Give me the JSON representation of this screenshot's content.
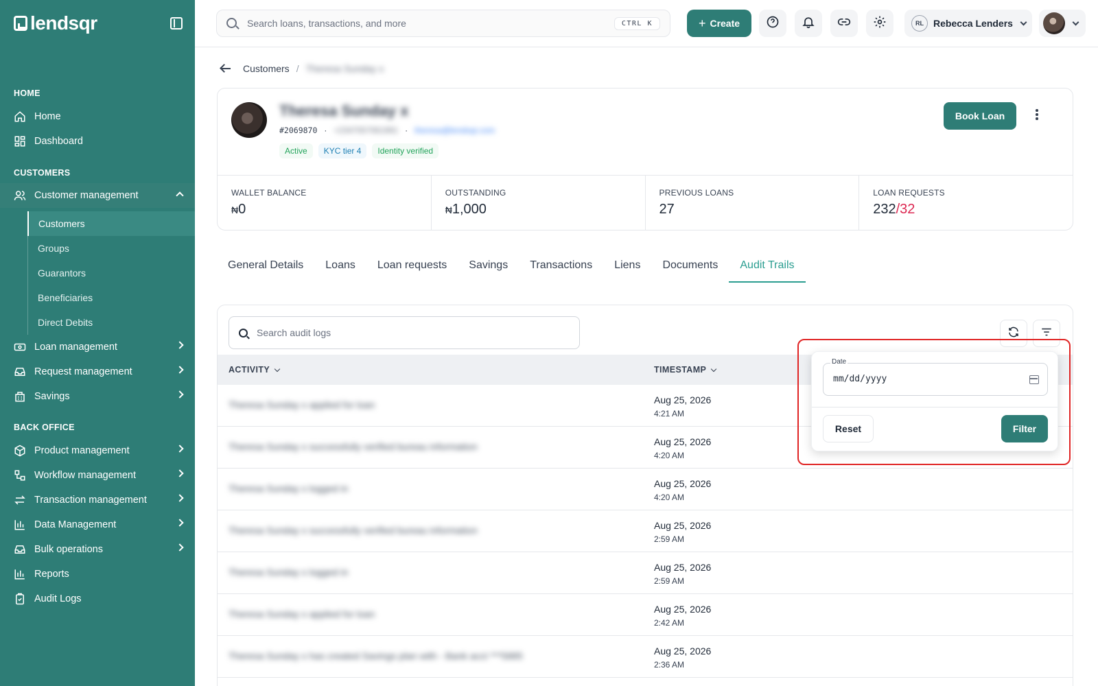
{
  "brand": {
    "name": "lendsqr"
  },
  "sidebar": {
    "sections": {
      "home": "HOME",
      "customers": "CUSTOMERS",
      "back_office": "BACK OFFICE"
    },
    "items": {
      "home": "Home",
      "dashboard": "Dashboard",
      "customer_management": "Customer management",
      "loan_management": "Loan management",
      "request_management": "Request management",
      "savings": "Savings",
      "product_management": "Product management",
      "workflow_management": "Workflow management",
      "transaction_management": "Transaction management",
      "data_management": "Data Management",
      "bulk_operations": "Bulk operations",
      "reports": "Reports",
      "audit_logs": "Audit Logs"
    },
    "sub_items": [
      "Customers",
      "Groups",
      "Guarantors",
      "Beneficiaries",
      "Direct Debits"
    ]
  },
  "topbar": {
    "search_placeholder": "Search loans, transactions, and more",
    "shortcut": "CTRL K",
    "create_label": "Create",
    "user_initials": "RL",
    "user_name": "Rebecca Lenders"
  },
  "breadcrumb": {
    "root": "Customers",
    "separator": "/",
    "current": "Theresa Sunday x"
  },
  "customer": {
    "name": "Theresa Sunday x",
    "id": "#2069870",
    "phone": "+2347057061991",
    "email": "theresa@lendsqr.com",
    "badges": [
      "Active",
      "KYC tier 4",
      "Identity verified"
    ],
    "book_loan_label": "Book Loan",
    "stats": [
      {
        "label": "WALLET BALANCE",
        "currency": "₦",
        "value": "0"
      },
      {
        "label": "OUTSTANDING",
        "currency": "₦",
        "value": "1,000"
      },
      {
        "label": "PREVIOUS LOANS",
        "value": "27"
      },
      {
        "label": "LOAN REQUESTS",
        "value": "232",
        "value_red": "/32"
      }
    ]
  },
  "tabs": [
    "General Details",
    "Loans",
    "Loan requests",
    "Savings",
    "Transactions",
    "Liens",
    "Documents",
    "Audit Trails"
  ],
  "audit": {
    "search_placeholder": "Search audit logs",
    "columns": {
      "activity": "ACTIVITY",
      "timestamp": "TIMESTAMP"
    },
    "rows": [
      {
        "activity": "Theresa Sunday x applied for loan",
        "date": "Aug 25, 2026",
        "time": "4:21 AM"
      },
      {
        "activity": "Theresa Sunday x successfully verified bureau information",
        "date": "Aug 25, 2026",
        "time": "4:20 AM"
      },
      {
        "activity": "Theresa Sunday x logged in",
        "date": "Aug 25, 2026",
        "time": "4:20 AM"
      },
      {
        "activity": "Theresa Sunday x successfully verified bureau information",
        "date": "Aug 25, 2026",
        "time": "2:59 AM"
      },
      {
        "activity": "Theresa Sunday x logged in",
        "date": "Aug 25, 2026",
        "time": "2:59 AM"
      },
      {
        "activity": "Theresa Sunday x applied for loan",
        "date": "Aug 25, 2026",
        "time": "2:42 AM"
      },
      {
        "activity": "Theresa Sunday x has created Savings plan with - Bank acct ***5885",
        "date": "Aug 25, 2026",
        "time": "2:36 AM"
      }
    ]
  },
  "filter_popover": {
    "date_label": "Date",
    "date_placeholder": "mm/dd/yyyy",
    "reset_label": "Reset",
    "filter_label": "Filter"
  },
  "colors": {
    "primary": "#2e7d76",
    "accent_tab": "#2a9d90",
    "danger": "#dc2650",
    "highlight": "#e02424"
  }
}
